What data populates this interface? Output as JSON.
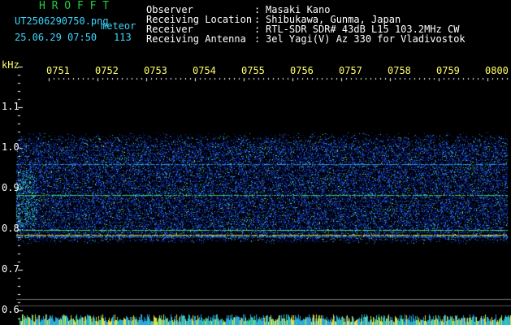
{
  "header": {
    "brand": "H R O F F T",
    "filename": "UT2506290750.png",
    "type_label": "meteor",
    "datetime": "25.06.29 07:50",
    "count": "113",
    "info": [
      {
        "label": "Observer",
        "value": "Masaki Kano"
      },
      {
        "label": "Receiving Location",
        "value": "Shibukawa, Gunma, Japan"
      },
      {
        "label": "Receiver",
        "value": "RTL-SDR SDR# 43dB L15 103.2MHz CW"
      },
      {
        "label": "Receiving Antenna",
        "value": "3el Yagi(V) Az 330 for Vladivostok"
      }
    ]
  },
  "axis": {
    "unit": "kHz",
    "y_ticks": [
      "1.1",
      "1.0",
      "0.9",
      "0.8",
      "0.7",
      "0.6"
    ],
    "x_ticks": [
      "0751",
      "0752",
      "0753",
      "0754",
      "0755",
      "0756",
      "0757",
      "0758",
      "0759",
      "0800"
    ]
  },
  "colors": {
    "background": "#000000",
    "brand": "#22cc44",
    "filename": "#3ad7ff",
    "axis_text": "#ffff66",
    "noise_base": "#0a1a8a"
  }
}
